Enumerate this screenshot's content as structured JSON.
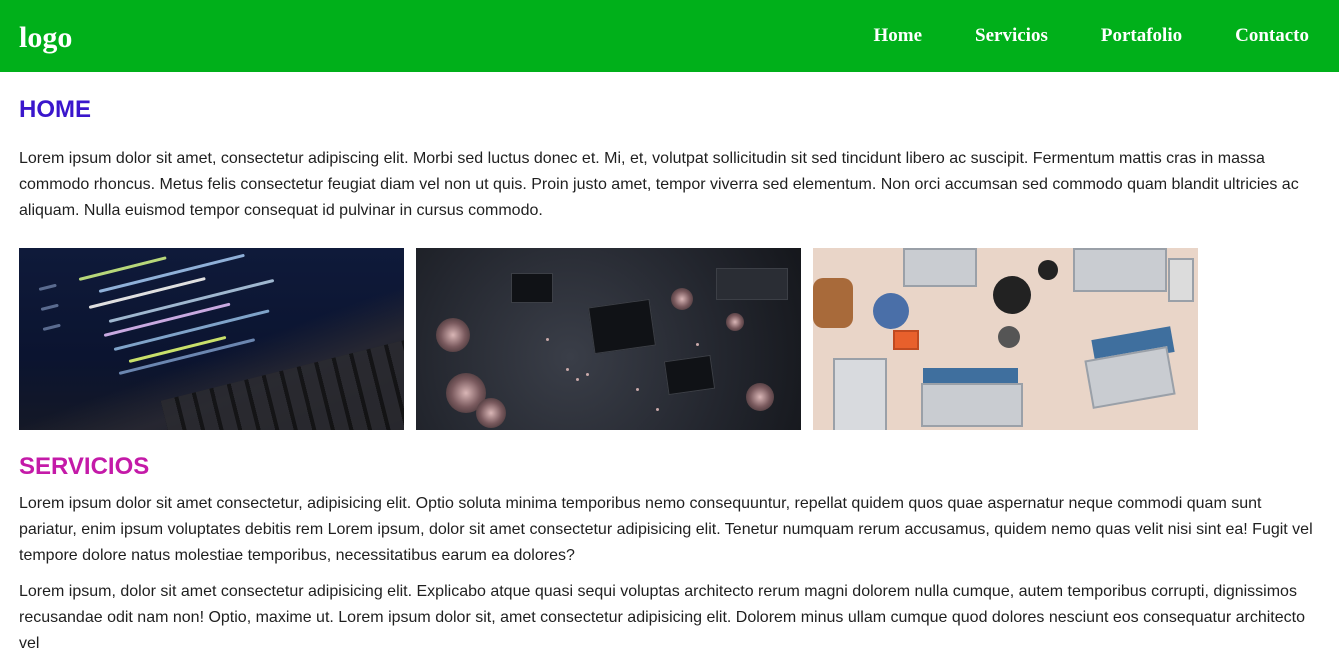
{
  "header": {
    "logo": "logo",
    "nav": [
      "Home",
      "Servicios",
      "Portafolio",
      "Contacto"
    ]
  },
  "home": {
    "title": "HOME",
    "text": "Lorem ipsum dolor sit amet, consectetur adipiscing elit. Morbi sed luctus donec et. Mi, et, volutpat sollicitudin sit sed tincidunt libero ac suscipit. Fermentum mattis cras in massa commodo rhoncus. Metus felis consectetur feugiat diam vel non ut quis. Proin justo amet, tempor viverra sed elementum. Non orci accumsan sed commodo quam blandit ultricies ac aliquam. Nulla euismod tempor consequat id pulvinar in cursus commodo."
  },
  "servicios": {
    "title": "SERVICIOS",
    "text1": "Lorem ipsum dolor sit amet consectetur, adipisicing elit. Optio soluta minima temporibus nemo consequuntur, repellat quidem quos quae aspernatur neque commodi quam sunt pariatur, enim ipsum voluptates debitis rem Lorem ipsum, dolor sit amet consectetur adipisicing elit. Tenetur numquam rerum accusamus, quidem nemo quas velit nisi sint ea! Fugit vel tempore dolore natus molestiae temporibus, necessitatibus earum ea dolores?",
    "text2": "Lorem ipsum, dolor sit amet consectetur adipisicing elit. Explicabo atque quasi sequi voluptas architecto rerum magni dolorem nulla cumque, autem temporibus corrupti, dignissimos recusandae odit nam non! Optio, maxime ut. Lorem ipsum dolor sit, amet consectetur adipisicing elit. Dolorem minus ullam cumque quod dolores nesciunt eos consequatur architecto vel"
  },
  "colors": {
    "header_bg": "#00b01a",
    "home_title": "#3a16cc",
    "servicios_title": "#c41aa8"
  }
}
